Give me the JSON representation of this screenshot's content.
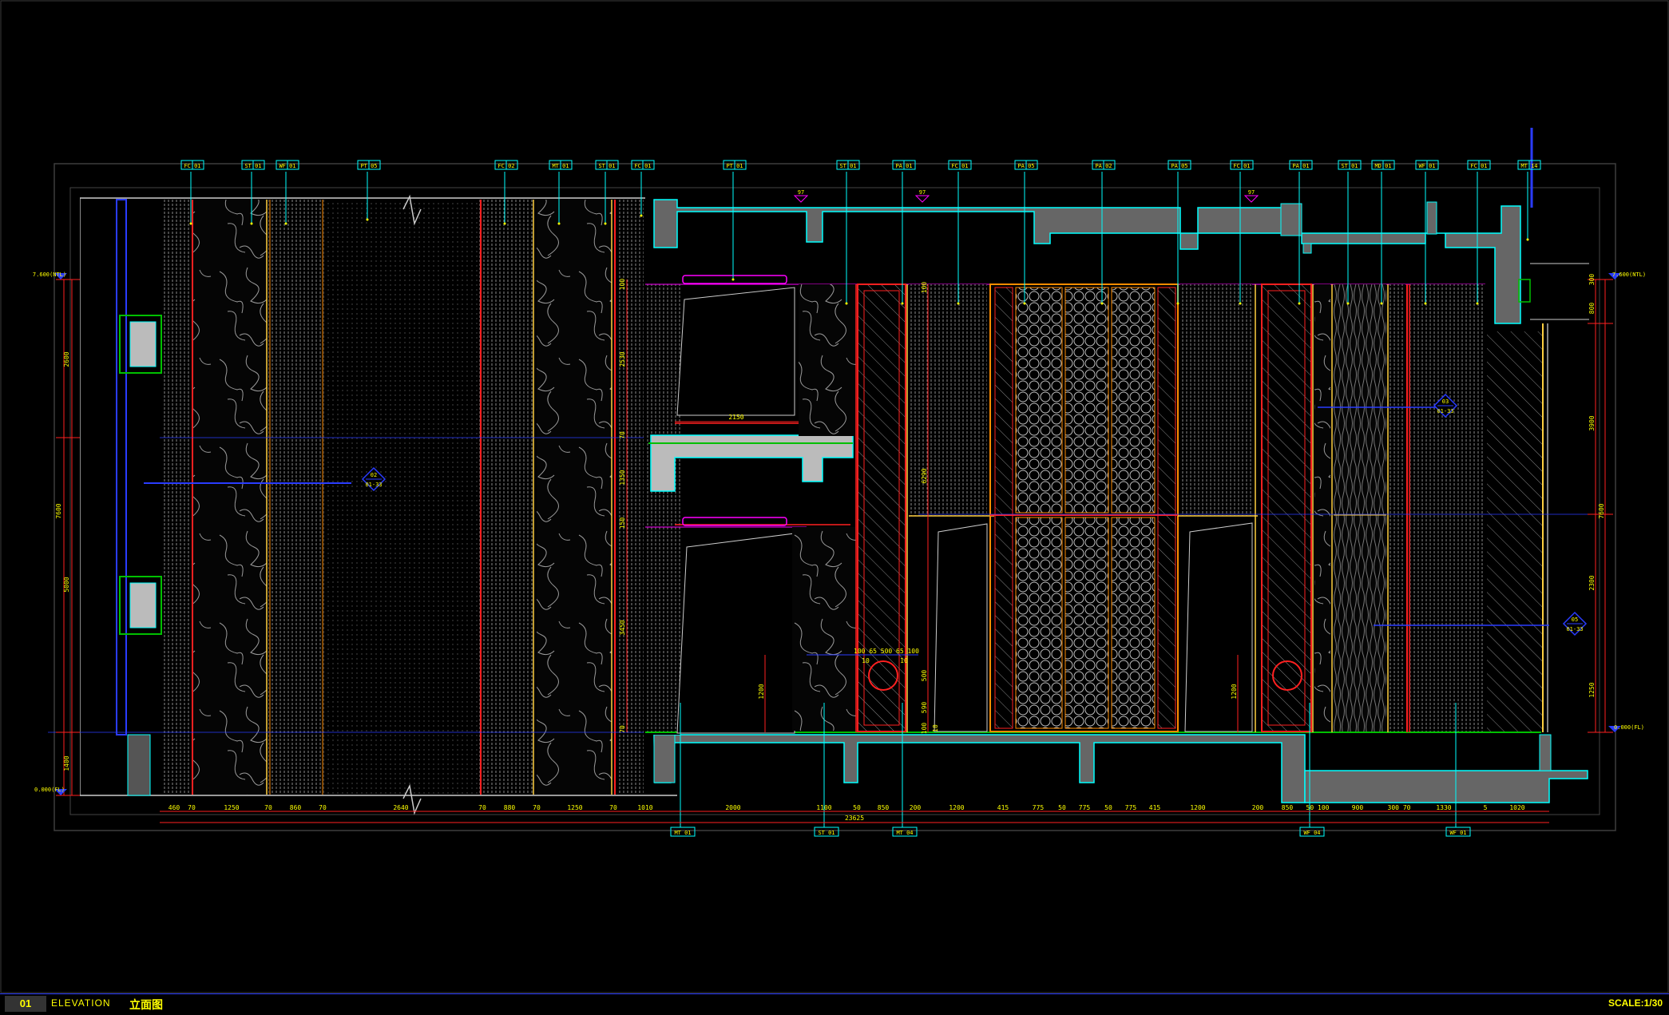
{
  "title_block": {
    "number": "01",
    "title_en": "ELEVATION",
    "title_cn": "立面图",
    "scale": "SCALE:1/30"
  },
  "material_tags_top": [
    "FC 01",
    "ST 01",
    "WF 01",
    "PT 05",
    "FC 02",
    "MT 01",
    "ST 01",
    "FC 01",
    "PT 01",
    "ST 01",
    "PA 01",
    "FC 01",
    "PA 05",
    "PA 02",
    "PA 05",
    "FC 01",
    "PA 01",
    "ST 01",
    "MD 01",
    "WF 01",
    "FC 01",
    "MT 14"
  ],
  "material_tags_bottom": [
    "MT 01",
    "ST 01",
    "MT 04",
    "WF 04",
    "WF 01"
  ],
  "section_marks": [
    "97",
    "97",
    "97"
  ],
  "callouts": [
    {
      "id": "02",
      "ref": "01-33"
    },
    {
      "id": "03",
      "ref": "01-33"
    },
    {
      "id": "05",
      "ref": "01-33"
    }
  ],
  "levels": {
    "left_top": "7.600(NTL)",
    "left_bottom": "0.000(FL)",
    "right_top": "7.600(NTL)",
    "right_bottom": "0.000(FL)"
  },
  "left_dims_outer": [
    "2600",
    "5000",
    "1400"
  ],
  "left_dims_total": "7600",
  "right_dims_outer": [
    "3900",
    "2300",
    "1250"
  ],
  "right_dims_total": "7600",
  "right_dims_small": [
    "300",
    "800"
  ],
  "mid_dims": [
    "100",
    "2530",
    "70",
    "1350",
    "150",
    "3450",
    "70"
  ],
  "mid_small_dims": [
    "100",
    "6290",
    "500",
    "590",
    "100",
    "10"
  ],
  "dim_2150": "2150",
  "dim_1200a": "1200",
  "dim_1200b": "1200",
  "circle_dims": "100 65 500 65 100",
  "circle_small": [
    "10",
    "10"
  ],
  "bottom_dims": [
    "460",
    "70",
    "1250",
    "70",
    "860",
    "70",
    "2640",
    "70",
    "880",
    "70",
    "1250",
    "70",
    "1010",
    "2000",
    "1100",
    "50",
    "850",
    "200",
    "1200",
    "415",
    "775",
    "50",
    "775",
    "50",
    "775",
    "415",
    "1200",
    "200",
    "850",
    "50 100",
    "900",
    "300 70",
    "1330",
    "5",
    "1020"
  ],
  "bottom_total": "23625"
}
